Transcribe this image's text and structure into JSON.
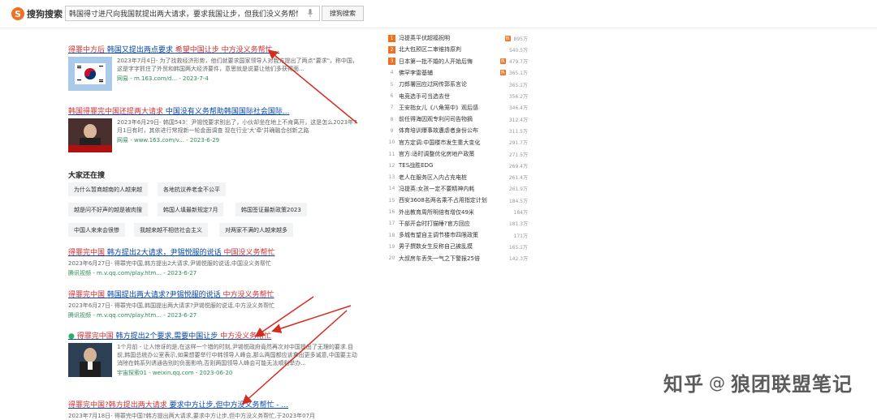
{
  "header": {
    "logo_text": "搜狗搜索",
    "search_value": "韩国得寸进尺向我国就提出两大请求，要求我国让步，但我们没义务帮忙",
    "search_button": "搜狗搜索"
  },
  "results": [
    {
      "title_hl1": "得罪中方后",
      "title_mid": " 韩国又提出两点要求 ",
      "title_rest": "希望中国让步 中方没义务帮忙...",
      "snippet": "2023年7月4日- 为了找救经济形势，他们就要求国家领导人对我方提出了两点\"要求\"，称中国，这是字字抓住了外贸和韩国两大经济要件，意思就是说要让他们多获得面...",
      "source": "网易 - m.163.com/d... - 2023-7-4"
    },
    {
      "title_hl1": "韩国得罪完中国还提两大请求",
      "title_mid": " 中国没有义务帮助韩国国际社会国际...",
      "title_rest": "",
      "snippet": "2023年6月29日- 韩国543：尹锡悦要求别出了，小伙却坐在地上不肯离开，这是怎么2023年7月1日有时，其依进行常规新一轮金面调查 现在行业'大'牵'并确融合创新之路",
      "source": "网易 - www.163.com/v... - 2023-6-29"
    },
    {
      "title_hl1": "得罪完中国",
      "title_mid": " 韩方提出2大请求，尹锡悦服的说话 ",
      "title_rest": "中国没义务帮忙",
      "snippet": "2023年6月27日- 得罪完中国,韩方提出2大请求,尹锡悦服的说话,中国没义务帮忙",
      "source": "腾讯视频 - m.v.qq.com/play.htm... - 2023-6-27"
    },
    {
      "title_hl1": "得罪完中国",
      "title_mid": " 韩国提出两大请求?尹锡悦服的说话 ",
      "title_rest": "中方没义务帮忙",
      "snippet": "2023年6月27日- 得罪完中国,韩国提出两大请求?尹锡悦服的说话,中方没义务帮忙",
      "source": "腾讯视频 - m.v.qq.com/play.htm... - 2023-6-27"
    },
    {
      "title_hl1": "得罪完中国",
      "title_mid": " 韩方提出2个要求,需要中国让步 ",
      "title_rest": "中方没义务帮忙",
      "snippet": "1个月前 - 让人惊讶的是,在这样一个错的时刻,尹锡悦政府竟然再次对中国提出了无理的要求.目前,韩国总统办公室表示,如果想要举行中韩领导人峰会,那么两国都应该拿出更多诚意,中国要主动消除在韩系列诱通告别的负面影响,否则两国领导人峰会可能无法顺利举办...",
      "source": "宇宙探索01 - weixin.qq.com - 2023-06-20"
    },
    {
      "title_hl1": "得罪完中国?韩方提出两大请求",
      "title_mid": " 要求中方让步,但中方没义务帮忙 - ...",
      "title_rest": "",
      "snippet": "2023年7月18日- 得罪完中国?韩方提出两大请求,要求中方让步,但中方没义务帮忙,于2023年07月",
      "source": ""
    }
  ],
  "related": {
    "title": "大家还在搜",
    "chips": [
      "为什么暂商越南的人越来越",
      "各地抗议养老金不公平",
      "越是问不好声的越是被肉搜",
      "韩国人填最新规定7月",
      "韩国签证最新政策2023",
      "中国人来来会很惨",
      "我越来越不相信社会主义",
      "对两家不满的人越来越多"
    ]
  },
  "hot": [
    {
      "rank": "1",
      "text": "冯提英平伏超福祝明",
      "badge": "热",
      "count": "895万"
    },
    {
      "rank": "2",
      "text": "北大包预区二审维持原判",
      "badge": "",
      "count": "540.5万"
    },
    {
      "rank": "3",
      "text": "日本第一批不婚的人开始后悔",
      "badge": "热",
      "count": "479.7万"
    },
    {
      "rank": "4",
      "text": "佛罕李雷基辅",
      "badge": "热",
      "count": "365.1万"
    },
    {
      "rank": "5",
      "text": "刀郎署回应过网传郭系言论",
      "badge": "",
      "count": "365.1万"
    },
    {
      "rank": "6",
      "text": "电竞选手可当选去世",
      "badge": "",
      "count": "356.2万"
    },
    {
      "rank": "7",
      "text": "王安指女儿《八角笼中》观后感",
      "badge": "",
      "count": "346.4万"
    },
    {
      "rank": "8",
      "text": "前任得海因观专利问司告物摘",
      "badge": "",
      "count": "312.4万"
    },
    {
      "rank": "9",
      "text": "体育培训爆事故遭虐者身份公布",
      "badge": "",
      "count": "311.5万"
    },
    {
      "rank": "10",
      "text": "官方定调:中国楼市发生重大变化",
      "badge": "",
      "count": "291.7万"
    },
    {
      "rank": "11",
      "text": "官方:适时调整优化房地产政策",
      "badge": "",
      "count": "271.5万"
    },
    {
      "rank": "12",
      "text": "TES战胜EDG",
      "badge": "",
      "count": "269.4万"
    },
    {
      "rank": "13",
      "text": "老人在服务区入内占充电桩",
      "badge": "",
      "count": "261.4万"
    },
    {
      "rank": "14",
      "text": "冯提英:女孩一定不要精神内耗",
      "badge": "",
      "count": "261.9万"
    },
    {
      "rank": "15",
      "text": "西安3608名两名乘不占用指定计划",
      "badge": "",
      "count": "184.5万"
    },
    {
      "rank": "16",
      "text": "外出教育周所明倍有增仅49米",
      "badge": "",
      "count": "184万"
    },
    {
      "rank": "17",
      "text": "干部开会时打猫睡?官方回应",
      "badge": "",
      "count": "181.3万"
    },
    {
      "rank": "18",
      "text": "多城有望自主调节楼市四限政策",
      "badge": "",
      "count": "171万"
    },
    {
      "rank": "19",
      "text": "男子撰数女生反称自己被乱摸",
      "badge": "",
      "count": "165.1万"
    },
    {
      "rank": "20",
      "text": "大叔房车丢失一气之下警报25倍",
      "badge": "",
      "count": "142.3万"
    }
  ],
  "watermark": {
    "brand": "知乎",
    "handle": "狼团联盟笔记"
  }
}
